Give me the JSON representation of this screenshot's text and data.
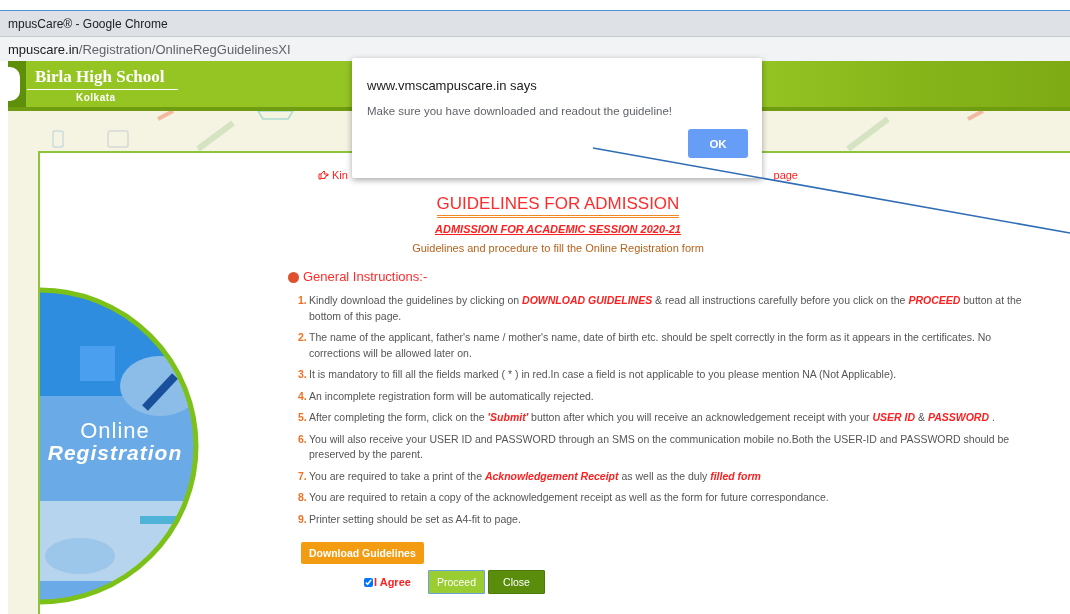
{
  "browser": {
    "title": "mpusCare® - Google Chrome",
    "url_host": "mpuscare.in",
    "url_path": "/Registration/OnlineRegGuidelinesXI"
  },
  "header": {
    "school": "Birla High School",
    "city": "Kolkata"
  },
  "banner": {
    "line_1": "Online",
    "line_2": "Registration"
  },
  "notice": {
    "start": "Kin",
    "end": "page"
  },
  "title": "GUIDELINES FOR ADMISSION",
  "session": "ADMISSION FOR ACADEMIC SESSION 2020-21",
  "subtitle": "Guidelines and procedure to fill the Online Registration form",
  "section": "General Instructions:-",
  "instructions": [
    {
      "number": "1.",
      "text": "Kindly download the guidelines by clicking on **DOWNLOAD GUIDELINES** & read all instructions carefully before you click on the **PROCEED** button at the bottom of this page."
    },
    {
      "number": "2.",
      "text": "The name of the applicant, father's name / mother's name, date of birth etc. should be spelt correctly in the form as it appears in the certificates. No corrections will be allowed later on."
    },
    {
      "number": "3.",
      "text": "It is mandatory to fill all the fields marked ( * ) in red.In case a field is not applicable to you please mention NA (Not Applicable)."
    },
    {
      "number": "4.",
      "text": "An incomplete registration form will be automatically rejected."
    },
    {
      "number": "5.",
      "text": "After completing the form, click on the **'Submit'** button after which you will receive an acknowledgement receipt with your **USER ID** & **PASSWORD** ."
    },
    {
      "number": "6.",
      "text": "You will also receive your USER ID and PASSWORD through an SMS on the communication mobile no.Both the USER-ID and PASSWORD should be preserved by the parent."
    },
    {
      "number": "7.",
      "text": "You are required to take a print of the  **Acknowledgement Receipt** as well as the duly **filled form**"
    },
    {
      "number": "8.",
      "text": "You are required to retain a copy of the acknowledgement receipt as well as the form for future correspondance."
    },
    {
      "number": "9.",
      "text": "Printer setting should be set as A4-fit to page."
    }
  ],
  "download_button": "Download Guidelines",
  "agree": {
    "label": "I Agree",
    "checked": true
  },
  "buttons": [
    {
      "label": "Proceed",
      "kind": "primary"
    },
    {
      "label": "Close",
      "kind": "secondary"
    }
  ],
  "dialog": {
    "origin": "www.vmscampuscare.in says",
    "message": "Make sure you have downloaded and readout the guideline!",
    "button": "OK"
  }
}
